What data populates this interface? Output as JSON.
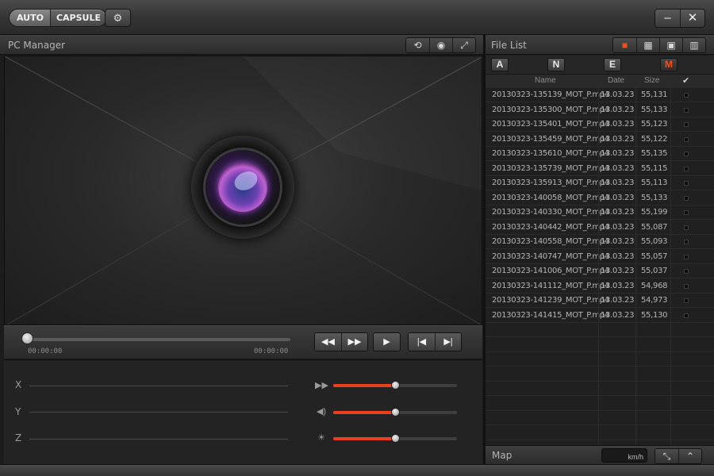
{
  "toolbar": {
    "auto_label": "AUTO",
    "capsule_label": "CAPSULE",
    "settings_icon": "gear-icon",
    "minimize_icon": "minimize-icon",
    "close_icon": "close-icon"
  },
  "player": {
    "title": "PC Manager",
    "header_icons": [
      "repeat-icon",
      "camera-icon",
      "fullscreen-icon"
    ],
    "time_start": "00:00:00",
    "time_end": "00:00:00",
    "progress": 0,
    "transport_icons": [
      "rewind-icon",
      "fast-forward-icon",
      "play-icon",
      "previous-icon",
      "next-icon"
    ]
  },
  "sensors": {
    "axes": [
      "X",
      "Y",
      "Z"
    ],
    "controls": [
      {
        "icon": "speed-icon",
        "level": 0.5
      },
      {
        "icon": "volume-icon",
        "level": 0.5
      },
      {
        "icon": "brightness-icon",
        "level": 0.5
      }
    ]
  },
  "file_list": {
    "title": "File List",
    "header_icons": [
      "folder-icon",
      "calendar-icon",
      "save-icon",
      "trash-icon"
    ],
    "filter_tabs": [
      {
        "label": "A",
        "active": false
      },
      {
        "label": "N",
        "active": false
      },
      {
        "label": "E",
        "active": false
      },
      {
        "label": "M",
        "active": true
      }
    ],
    "columns": {
      "name": "Name",
      "date": "Date",
      "size": "Size",
      "check": "✔"
    },
    "rows": [
      {
        "name": "20130323-135139_MOT_P.mp4",
        "date": "13.03.23",
        "size": "55,131"
      },
      {
        "name": "20130323-135300_MOT_P.mp4",
        "date": "13.03.23",
        "size": "55,133"
      },
      {
        "name": "20130323-135401_MOT_P.mp4",
        "date": "13.03.23",
        "size": "55,123"
      },
      {
        "name": "20130323-135459_MOT_P.mp4",
        "date": "13.03.23",
        "size": "55,122"
      },
      {
        "name": "20130323-135610_MOT_P.mp4",
        "date": "13.03.23",
        "size": "55,135"
      },
      {
        "name": "20130323-135739_MOT_P.mp4",
        "date": "13.03.23",
        "size": "55,115"
      },
      {
        "name": "20130323-135913_MOT_P.mp4",
        "date": "13.03.23",
        "size": "55,113"
      },
      {
        "name": "20130323-140058_MOT_P.mp4",
        "date": "13.03.23",
        "size": "55,133"
      },
      {
        "name": "20130323-140330_MOT_P.mp4",
        "date": "13.03.23",
        "size": "55,199"
      },
      {
        "name": "20130323-140442_MOT_P.mp4",
        "date": "13.03.23",
        "size": "55,087"
      },
      {
        "name": "20130323-140558_MOT_P.mp4",
        "date": "13.03.23",
        "size": "55,093"
      },
      {
        "name": "20130323-140747_MOT_P.mp4",
        "date": "13.03.23",
        "size": "55,057"
      },
      {
        "name": "20130323-141006_MOT_P.mp4",
        "date": "13.03.23",
        "size": "55,037"
      },
      {
        "name": "20130323-141112_MOT_P.mp4",
        "date": "13.03.23",
        "size": "54,968"
      },
      {
        "name": "20130323-141239_MOT_P.mp4",
        "date": "13.03.23",
        "size": "54,973"
      },
      {
        "name": "20130323-141415_MOT_P.mp4",
        "date": "13.03.23",
        "size": "55,130"
      }
    ]
  },
  "map": {
    "title": "Map",
    "speed_unit": "km/h",
    "icons": [
      "expand-icon",
      "collapse-up-icon"
    ]
  },
  "colors": {
    "accent": "#e8401c",
    "background": "#1c1c1c"
  }
}
